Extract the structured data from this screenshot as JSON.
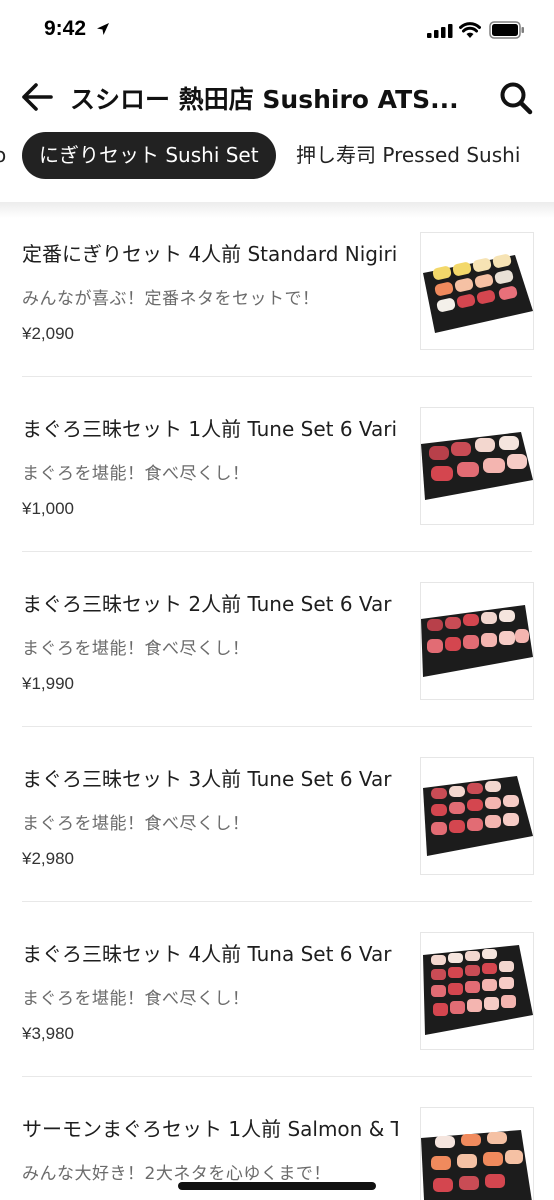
{
  "status_bar": {
    "time": "9:42",
    "icons": [
      "location-arrow-icon",
      "signal-icon",
      "wifi-icon",
      "battery-icon"
    ]
  },
  "header": {
    "back_icon": "arrow-left-icon",
    "title": "スシロー 熱田店 Sushiro ATS...",
    "search_icon": "search-icon"
  },
  "tabs": {
    "partial_left": "o",
    "active": "にぎりセット Sushi Set",
    "next": "押し寿司 Pressed Sushi"
  },
  "menu_items": [
    {
      "name": "定番にぎりセット 4人前 Standard Nigiri",
      "description": "みんなが喜ぶ！定番ネタをセットで！",
      "price": "¥2,090"
    },
    {
      "name": "まぐろ三昧セット 1人前 Tune Set 6 Vari",
      "description": "まぐろを堪能！食べ尽くし！",
      "price": "¥1,000"
    },
    {
      "name": "まぐろ三昧セット 2人前 Tune Set 6 Var",
      "description": "まぐろを堪能！食べ尽くし！",
      "price": "¥1,990"
    },
    {
      "name": "まぐろ三昧セット 3人前 Tune Set 6 Var",
      "description": "まぐろを堪能！食べ尽くし！",
      "price": "¥2,980"
    },
    {
      "name": "まぐろ三昧セット 4人前 Tuna Set 6 Var",
      "description": "まぐろを堪能！食べ尽くし！",
      "price": "¥3,980"
    },
    {
      "name": "サーモンまぐろセット 1人前 Salmon & T",
      "description": "みんな大好き！2大ネタを心ゆくまで！",
      "price": ""
    }
  ],
  "colors": {
    "active_tab_bg": "#222222",
    "tuna": "#d4464f",
    "salmon": "#f08a5d",
    "tray": "#1c1c1c"
  }
}
